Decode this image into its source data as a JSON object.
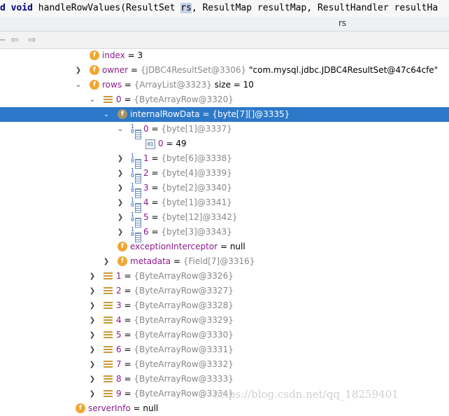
{
  "code": {
    "kw1": "d",
    "kw2": "void",
    "before": " handleRowValues(ResultSet ",
    "highlight": "rs",
    "after": ", ResultMap resultMap, ResultHandler resultHa"
  },
  "tooltip": {
    "title": "rs"
  },
  "toolbar": {
    "icons": [
      "minus-icon",
      "back-arrow-icon",
      "forward-arrow-icon"
    ]
  },
  "tree": {
    "index": {
      "name": "index",
      "eq": " = ",
      "value": "3"
    },
    "owner": {
      "name": "owner",
      "eq": " = ",
      "type": "{JDBC4ResultSet@3306}",
      "value": " \"com.mysql.jdbc.JDBC4ResultSet@47c64cfe\""
    },
    "rows": {
      "name": "rows",
      "eq": " = ",
      "type": "{ArrayList@3323}",
      "value": "  size = 10"
    },
    "row0": {
      "name": "0",
      "eq": " = ",
      "type": "{ByteArrayRow@3320}"
    },
    "internalRowData": {
      "name": "internalRowData",
      "eq": " = ",
      "type": "{byte[7][]@3335}"
    },
    "bytes": [
      {
        "name": "0",
        "eq": " = ",
        "type": "{byte[1]@3337}"
      },
      {
        "name": "1",
        "eq": " = ",
        "type": "{byte[6]@3338}"
      },
      {
        "name": "2",
        "eq": " = ",
        "type": "{byte[4]@3339}"
      },
      {
        "name": "3",
        "eq": " = ",
        "type": "{byte[2]@3340}"
      },
      {
        "name": "4",
        "eq": " = ",
        "type": "{byte[1]@3341}"
      },
      {
        "name": "5",
        "eq": " = ",
        "type": "{byte[12]@3342}"
      },
      {
        "name": "6",
        "eq": " = ",
        "type": "{byte[3]@3343}"
      }
    ],
    "byteValue": {
      "name": "0",
      "eq": " = ",
      "value": "49"
    },
    "exceptionInterceptor": {
      "name": "exceptionInterceptor",
      "eq": " = ",
      "value": "null"
    },
    "metadata": {
      "name": "metadata",
      "eq": " = ",
      "type": "{Field[7]@3316}"
    },
    "rowsList": [
      {
        "name": "1",
        "eq": " = ",
        "type": "{ByteArrayRow@3326}"
      },
      {
        "name": "2",
        "eq": " = ",
        "type": "{ByteArrayRow@3327}"
      },
      {
        "name": "3",
        "eq": " = ",
        "type": "{ByteArrayRow@3328}"
      },
      {
        "name": "4",
        "eq": " = ",
        "type": "{ByteArrayRow@3329}"
      },
      {
        "name": "5",
        "eq": " = ",
        "type": "{ByteArrayRow@3330}"
      },
      {
        "name": "6",
        "eq": " = ",
        "type": "{ByteArrayRow@3331}"
      },
      {
        "name": "7",
        "eq": " = ",
        "type": "{ByteArrayRow@3332}"
      },
      {
        "name": "8",
        "eq": " = ",
        "type": "{ByteArrayRow@3333}"
      },
      {
        "name": "9",
        "eq": " = ",
        "type": "{ByteArrayRow@3334}"
      }
    ],
    "serverInfo": {
      "name": "serverInfo",
      "eq": " = ",
      "value": "null"
    }
  },
  "watermark": "https://blog.csdn.net/qq_18259401",
  "colors": {
    "selection": "#2d78c8",
    "field_icon": "#f0a732",
    "name": "#8b1a8b",
    "type": "#888888"
  }
}
